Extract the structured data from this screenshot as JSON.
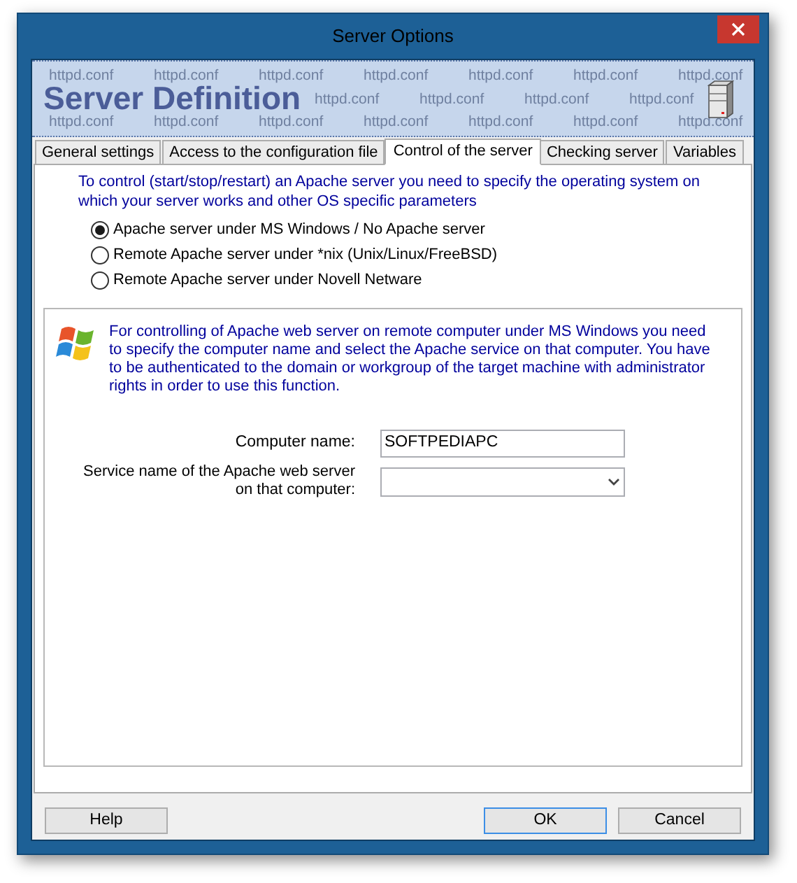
{
  "window": {
    "title": "Server Options"
  },
  "banner": {
    "title": "Server Definition",
    "pattern_rows": [
      [
        "httpd.conf",
        "httpd.conf",
        "httpd.conf",
        "httpd.conf",
        "httpd.conf",
        "httpd.conf",
        "httpd.conf"
      ],
      [
        "httpd.conf",
        "httpd.conf",
        "httpd.conf",
        "httpd.conf"
      ],
      [
        "httpd.conf",
        "httpd.conf",
        "httpd.conf",
        "httpd.conf",
        "httpd.conf",
        "httpd.conf",
        "httpd.conf"
      ]
    ]
  },
  "tabs": [
    {
      "label": "General settings",
      "selected": false
    },
    {
      "label": "Access to the configuration file",
      "selected": false
    },
    {
      "label": "Control of the server",
      "selected": true
    },
    {
      "label": "Checking server",
      "selected": false
    },
    {
      "label": "Variables",
      "selected": false
    }
  ],
  "intro": "To control (start/stop/restart) an Apache server you need to specify the operating system on which your server works and other OS specific parameters",
  "os_options": [
    {
      "label": "Apache server under MS Windows / No Apache server",
      "selected": true
    },
    {
      "label": "Remote Apache server under *nix (Unix/Linux/FreeBSD)",
      "selected": false
    },
    {
      "label": "Remote Apache server under Novell Netware",
      "selected": false
    }
  ],
  "windows_panel": {
    "description": "For controlling of Apache web server on remote computer under MS Windows you need to specify the computer name and select the Apache service on that computer. You have to be authenticated to the domain or workgroup of the target machine with administrator rights in order to use this function.",
    "computer_name": {
      "label": "Computer name:",
      "value": "SOFTPEDIAPC"
    },
    "service_name": {
      "label": "Service name of the Apache web server on that computer:"
    }
  },
  "buttons": [
    {
      "label": "Help",
      "default": false
    },
    {
      "label": "OK",
      "default": true
    },
    {
      "label": "Cancel",
      "default": false
    }
  ]
}
